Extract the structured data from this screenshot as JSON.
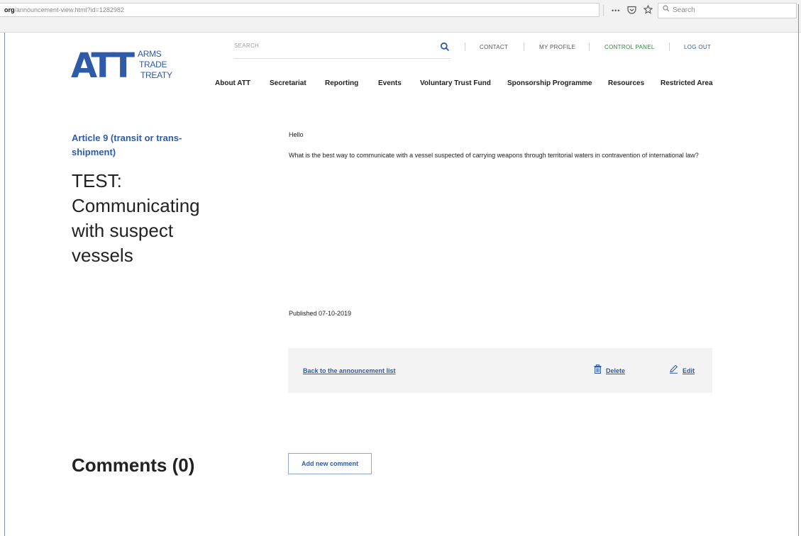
{
  "browser": {
    "url_host": "org",
    "url_path": "/announcement-view.html?id=1282982",
    "menu_glyph": "•••",
    "search_placeholder": "Search"
  },
  "logo": {
    "mark": "ATT",
    "words": [
      "ARMS",
      "TRADE",
      "TREATY"
    ]
  },
  "header": {
    "search_placeholder": "SEARCH",
    "top_links": {
      "contact": "CONTACT",
      "profile": "MY PROFILE",
      "control_panel": "CONTROL PANEL",
      "logout": "LOG OUT"
    },
    "main_nav": [
      "About ATT",
      "Secretariat",
      "Reporting",
      "Events",
      "Voluntary Trust Fund",
      "Sponsorship Programme",
      "Resources",
      "Restricted Area"
    ]
  },
  "colors": {
    "brand_blue": "#2f5aa8",
    "control_panel_green": "#2e8b3e"
  },
  "announcement": {
    "category": "Article 9 (transit or trans-shipment)",
    "title": "TEST: Communicating with suspect vessels",
    "greeting": "Hello",
    "body": "What is the best way to communicate with a vessel suspected of carrying weapons through territorial waters in contravention of international law?",
    "published": "Published 07-10-2019"
  },
  "actions": {
    "back": "Back to the announcement list",
    "delete": "Delete",
    "edit": "Edit"
  },
  "comments": {
    "title": "Comments (0)",
    "add_button": "Add new comment"
  }
}
